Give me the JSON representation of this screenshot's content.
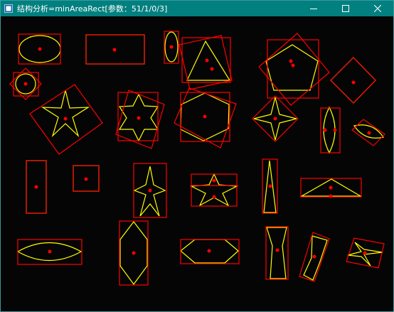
{
  "window": {
    "title": "结构分析=minAreaRect[参数：51/1/0/3]",
    "icons": {
      "app": "app-icon",
      "minimize": "minimize-icon",
      "maximize": "maximize-icon",
      "close": "close-icon"
    }
  },
  "colors": {
    "titlebar": "#01807f",
    "background": "#000000",
    "shape_outline": "#ffff00",
    "min_area_rect": "#ff0000",
    "center_point": "#ff0000"
  },
  "image": {
    "content": "shape outlines (yellow) with minimum-area bounding rectangles (red) and red center points",
    "shapes": [
      "ellipse",
      "rectangle",
      "ellipse",
      "triangle",
      "pentagon",
      "diamond",
      "circle",
      "star",
      "hexagram",
      "hexagon",
      "four-point star",
      "lens",
      "lens",
      "rectangle",
      "square",
      "star",
      "star",
      "narrow triangle",
      "triangle",
      "lens",
      "hexagon",
      "hexagon",
      "tapered bar",
      "tapered bar",
      "four-point star"
    ]
  }
}
